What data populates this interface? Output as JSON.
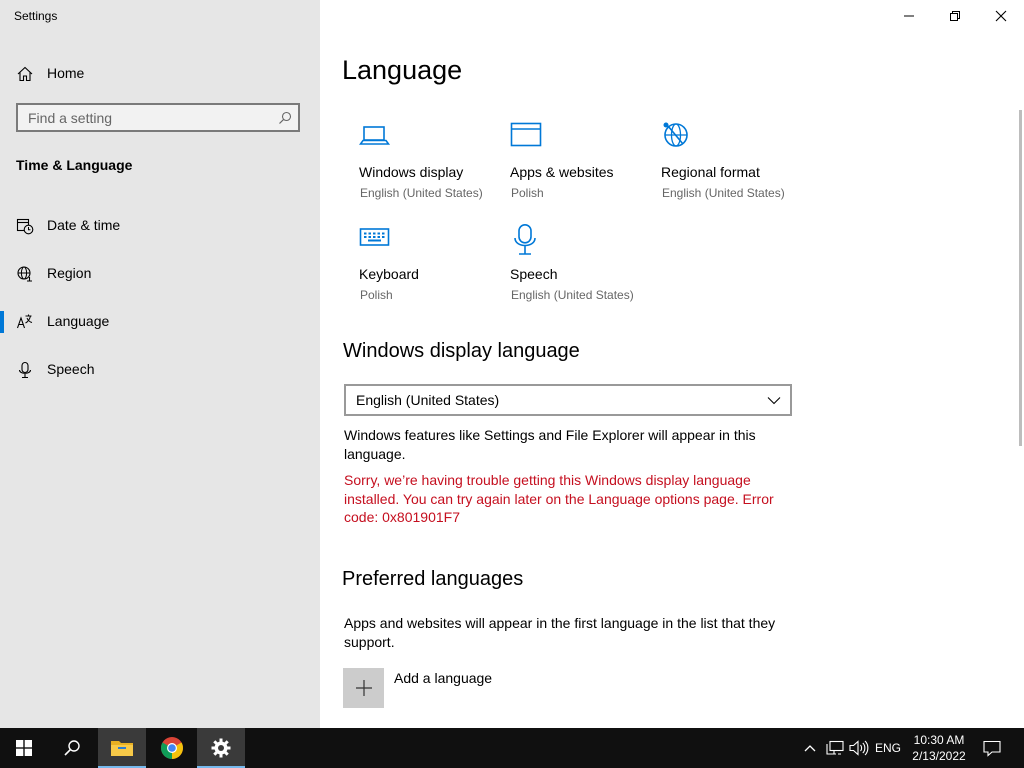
{
  "window": {
    "title": "Settings"
  },
  "sidebar": {
    "home_label": "Home",
    "search": {
      "placeholder": "Find a setting",
      "value": ""
    },
    "section_title": "Time & Language",
    "items": [
      {
        "label": "Date & time",
        "icon": "calendar-clock-icon"
      },
      {
        "label": "Region",
        "icon": "globe-icon"
      },
      {
        "label": "Language",
        "icon": "language-icon",
        "active": true
      },
      {
        "label": "Speech",
        "icon": "microphone-icon"
      }
    ]
  },
  "main": {
    "title": "Language",
    "tiles": [
      {
        "name": "Windows display",
        "sub": "English (United States)",
        "icon": "laptop-icon"
      },
      {
        "name": "Apps & websites",
        "sub": "Polish",
        "icon": "window-icon"
      },
      {
        "name": "Regional format",
        "sub": "English (United States)",
        "icon": "globe-settings-icon"
      },
      {
        "name": "Keyboard",
        "sub": "Polish",
        "icon": "keyboard-icon"
      },
      {
        "name": "Speech",
        "sub": "English (United States)",
        "icon": "microphone-icon"
      }
    ],
    "display_language": {
      "heading": "Windows display language",
      "selected": "English (United States)",
      "description": "Windows features like Settings and File Explorer will appear in this language.",
      "error": "Sorry, we’re having trouble getting this Windows display language installed. You can try again later on the Language options page. Error code: 0x801901F7"
    },
    "preferred": {
      "heading": "Preferred languages",
      "description": "Apps and websites will appear in the first language in the list that they support.",
      "add_label": "Add a language"
    }
  },
  "taskbar": {
    "apps": [
      "start-icon",
      "search-icon",
      "file-explorer-icon",
      "chrome-icon",
      "settings-icon"
    ],
    "tray": {
      "input_language": "ENG",
      "time": "10:30 AM",
      "date": "2/13/2022"
    }
  },
  "colors": {
    "accent": "#0078d7",
    "error": "#c50f1f",
    "sidebar_bg": "#e6e6e6",
    "taskbar_bg": "#101010"
  }
}
